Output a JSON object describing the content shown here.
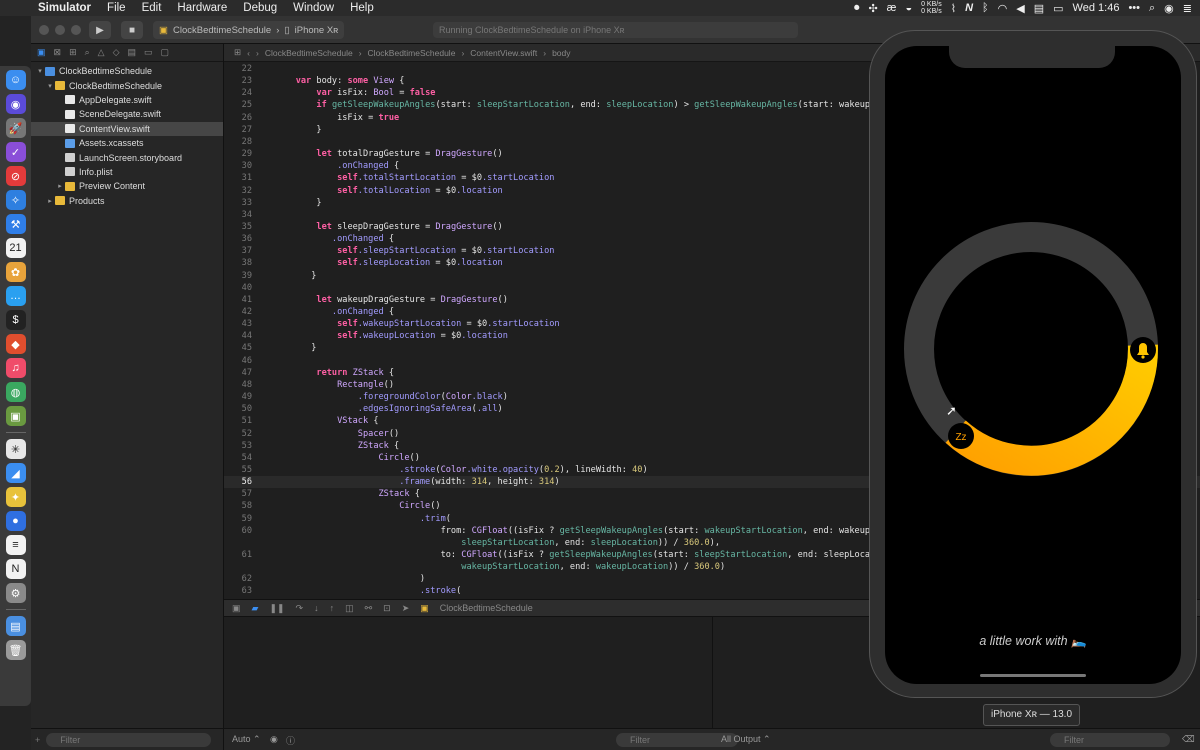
{
  "menubar": {
    "apple": "",
    "items": [
      "Simulator",
      "File",
      "Edit",
      "Hardware",
      "Debug",
      "Window",
      "Help"
    ],
    "net_up": "0 KB/s",
    "net_down": "0 KB/s",
    "clock": "Wed 1:46",
    "icons": [
      "record-icon",
      "gamepad-icon",
      "ae-icon",
      "drop-icon",
      "network-graph-icon",
      "n-icon",
      "bluetooth-icon",
      "wifi-icon",
      "volume-icon",
      "flag-icon",
      "battery-icon",
      "more-icon",
      "spotlight-icon",
      "siri-icon",
      "control-center-icon"
    ]
  },
  "dock": {
    "apps": [
      {
        "name": "finder-app",
        "color": "#3b8ef0",
        "glyph": "☺"
      },
      {
        "name": "siri-app",
        "color": "#5b4bd8",
        "glyph": "◉"
      },
      {
        "name": "launchpad-app",
        "color": "#777777",
        "glyph": "🚀"
      },
      {
        "name": "omnifocus-app",
        "color": "#8a4ed8",
        "glyph": "✓"
      },
      {
        "name": "news-app",
        "color": "#e33b3b",
        "glyph": "⊘"
      },
      {
        "name": "safari-app",
        "color": "#2e7fe0",
        "glyph": "✧"
      },
      {
        "name": "xcode-app",
        "color": "#2f7ee8",
        "glyph": "⚒"
      },
      {
        "name": "calendar-app",
        "color": "#f2f2f2",
        "glyph": "21"
      },
      {
        "name": "photos-app",
        "color": "#e8a33b",
        "glyph": "✿"
      },
      {
        "name": "messages-app",
        "color": "#2aa0f0",
        "glyph": "…"
      },
      {
        "name": "terminal-app",
        "color": "#222222",
        "glyph": "$"
      },
      {
        "name": "figma-app",
        "color": "#e04e2e",
        "glyph": "◆"
      },
      {
        "name": "music-app",
        "color": "#f04c6a",
        "glyph": "♫"
      },
      {
        "name": "maps-app",
        "color": "#3aa860",
        "glyph": "◍"
      },
      {
        "name": "preview-app",
        "color": "#6a9a40",
        "glyph": "▣"
      },
      {
        "name": "slack-app",
        "color": "#e8e8e8",
        "glyph": "✳"
      },
      {
        "name": "sim-app",
        "color": "#3b8ef0",
        "glyph": "◢"
      },
      {
        "name": "tes-app",
        "color": "#e8c23b",
        "glyph": "✦"
      },
      {
        "name": "location-app",
        "color": "#2f6fe0",
        "glyph": "●"
      },
      {
        "name": "notes-app",
        "color": "#f2f2f2",
        "glyph": "≡"
      },
      {
        "name": "notion-app",
        "color": "#f2f2f2",
        "glyph": "N"
      },
      {
        "name": "preferences-app",
        "color": "#8a8a8a",
        "glyph": "⚙"
      },
      {
        "name": "downloads-app",
        "color": "#4a8fe0",
        "glyph": "▤"
      },
      {
        "name": "trash-app",
        "color": "#9a9a9a",
        "glyph": "🗑"
      }
    ]
  },
  "toolbar": {
    "scheme": "ClockBedtimeSchedule",
    "device": "iPhone Xʀ",
    "activity": "Running ClockBedtimeSchedule on iPhone Xʀ"
  },
  "jumpbar": [
    "ClockBedtimeSchedule",
    "ClockBedtimeSchedule",
    "ContentView.swift",
    "body"
  ],
  "navigator": {
    "tree": [
      {
        "label": "ClockBedtimeSchedule",
        "indent": 0,
        "tri": "▾",
        "icon": "folder-blue"
      },
      {
        "label": "ClockBedtimeSchedule",
        "indent": 1,
        "tri": "▾",
        "icon": "folder-yellow"
      },
      {
        "label": "AppDelegate.swift",
        "indent": 2,
        "tri": "",
        "icon": "swift"
      },
      {
        "label": "SceneDelegate.swift",
        "indent": 2,
        "tri": "",
        "icon": "swift"
      },
      {
        "label": "ContentView.swift",
        "indent": 2,
        "tri": "",
        "icon": "swift",
        "selected": true
      },
      {
        "label": "Assets.xcassets",
        "indent": 2,
        "tri": "",
        "icon": "asset"
      },
      {
        "label": "LaunchScreen.storyboard",
        "indent": 2,
        "tri": "",
        "icon": "story"
      },
      {
        "label": "Info.plist",
        "indent": 2,
        "tri": "",
        "icon": "plist"
      },
      {
        "label": "Preview Content",
        "indent": 2,
        "tri": "▸",
        "icon": "folder-yellow"
      },
      {
        "label": "Products",
        "indent": 1,
        "tri": "▸",
        "icon": "folder-yellow"
      }
    ],
    "filter_placeholder": "Filter"
  },
  "code": {
    "current_line": 56,
    "lines": [
      {
        "n": 22,
        "t": ""
      },
      {
        "n": 23,
        "t": "    var body: some View {"
      },
      {
        "n": 24,
        "t": "        var isFix: Bool = false"
      },
      {
        "n": 25,
        "t": "        if getSleepWakeupAngles(start: sleepStartLocation, end: sleepLocation) > getSleepWakeupAngles(start: wakeup"
      },
      {
        "n": 26,
        "t": "            isFix = true"
      },
      {
        "n": 27,
        "t": "        }"
      },
      {
        "n": 28,
        "t": ""
      },
      {
        "n": 29,
        "t": "        let totalDragGesture = DragGesture()"
      },
      {
        "n": 30,
        "t": "            .onChanged {"
      },
      {
        "n": 31,
        "t": "            self.totalStartLocation = $0.startLocation"
      },
      {
        "n": 32,
        "t": "            self.totalLocation = $0.location"
      },
      {
        "n": 33,
        "t": "        }"
      },
      {
        "n": 34,
        "t": ""
      },
      {
        "n": 35,
        "t": "        let sleepDragGesture = DragGesture()"
      },
      {
        "n": 36,
        "t": "           .onChanged {"
      },
      {
        "n": 37,
        "t": "            self.sleepStartLocation = $0.startLocation"
      },
      {
        "n": 38,
        "t": "            self.sleepLocation = $0.location"
      },
      {
        "n": 39,
        "t": "       }"
      },
      {
        "n": 40,
        "t": ""
      },
      {
        "n": 41,
        "t": "        let wakeupDragGesture = DragGesture()"
      },
      {
        "n": 42,
        "t": "           .onChanged {"
      },
      {
        "n": 43,
        "t": "            self.wakeupStartLocation = $0.startLocation"
      },
      {
        "n": 44,
        "t": "            self.wakeupLocation = $0.location"
      },
      {
        "n": 45,
        "t": "       }"
      },
      {
        "n": 46,
        "t": ""
      },
      {
        "n": 47,
        "t": "        return ZStack {"
      },
      {
        "n": 48,
        "t": "            Rectangle()"
      },
      {
        "n": 49,
        "t": "                .foregroundColor(Color.black)"
      },
      {
        "n": 50,
        "t": "                .edgesIgnoringSafeArea(.all)"
      },
      {
        "n": 51,
        "t": "            VStack {"
      },
      {
        "n": 52,
        "t": "                Spacer()"
      },
      {
        "n": 53,
        "t": "                ZStack {"
      },
      {
        "n": 54,
        "t": "                    Circle()"
      },
      {
        "n": 55,
        "t": "                        .stroke(Color.white.opacity(0.2), lineWidth: 40)"
      },
      {
        "n": 56,
        "t": "                        .frame(width: 314, height: 314)"
      },
      {
        "n": 57,
        "t": "                    ZStack {"
      },
      {
        "n": 58,
        "t": "                        Circle()"
      },
      {
        "n": 59,
        "t": "                            .trim("
      },
      {
        "n": 60,
        "t": "                                from: CGFloat((isFix ? getSleepWakeupAngles(start: wakeupStartLocation, end: wakeup"
      },
      {
        "n": "",
        "t": "                                    sleepStartLocation, end: sleepLocation)) / 360.0),"
      },
      {
        "n": 61,
        "t": "                                to: CGFloat((isFix ? getSleepWakeupAngles(start: sleepStartLocation, end: sleepLoca"
      },
      {
        "n": "",
        "t": "                                    wakeupStartLocation, end: wakeupLocation)) / 360.0)"
      },
      {
        "n": 62,
        "t": "                            )"
      },
      {
        "n": 63,
        "t": "                            .stroke("
      }
    ]
  },
  "debugbar": {
    "target": "ClockBedtimeSchedule"
  },
  "bottombar": {
    "auto": "Auto ⌃",
    "filter_placeholder": "Filter",
    "output": "All Output ⌃",
    "filter_placeholder_right": "Filter"
  },
  "simulator": {
    "footer": "a little work with 🛌",
    "label": "iPhone Xʀ — 13.0",
    "sleep_icon": "Zz",
    "track_color": "#3a3a3a",
    "arc_color_start": "#ffa000",
    "arc_color_end": "#ffcc00"
  }
}
